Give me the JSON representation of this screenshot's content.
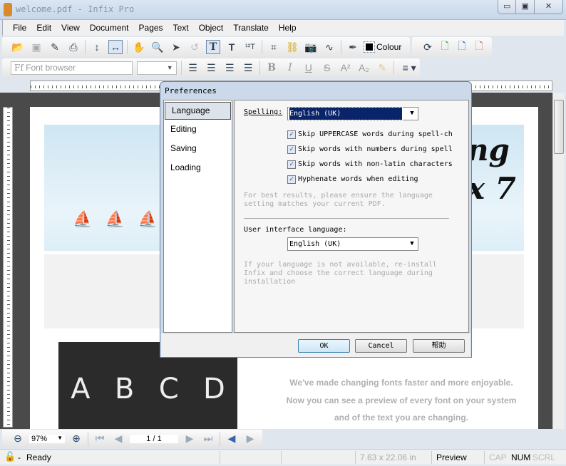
{
  "window": {
    "title": "welcome.pdf - Infix Pro",
    "minimize": "▭",
    "maximize": "▣",
    "close": "✕"
  },
  "menu": [
    "File",
    "Edit",
    "View",
    "Document",
    "Pages",
    "Text",
    "Object",
    "Translate",
    "Help"
  ],
  "toolbar": {
    "colour_label": "Colour",
    "font_browser_placeholder": "Font browser"
  },
  "document": {
    "heading_fragment_1": "ng",
    "heading_fragment_2": "x 7",
    "chalk_letters": [
      "A",
      "B",
      "C",
      "D"
    ],
    "lines": [
      "We've made changing fonts faster and more enjoyable.",
      "Now you can see a preview of every font on your system",
      "and of the text you are changing."
    ]
  },
  "dialog": {
    "title": "Preferences",
    "categories": [
      "Language",
      "Editing",
      "Saving",
      "Loading"
    ],
    "spelling_label": "Spelling:",
    "spelling_value": "English (UK)",
    "checkboxes": [
      "Skip UPPERCASE words during spell-ch",
      "Skip words with numbers during spell",
      "Skip words with non-latin characters",
      "Hyphenate words when editing"
    ],
    "hint1_line1": "For best results, please ensure the language",
    "hint1_line2": "setting matches your current PDF.",
    "ui_lang_label": "User interface language:",
    "ui_lang_value": "English (UK)",
    "hint2_line1": "If your language is not available, re-install",
    "hint2_line2": "Infix and choose the correct language during",
    "hint2_line3": "installation",
    "ok": "OK",
    "cancel": "Cancel",
    "help": "帮助"
  },
  "bottombar": {
    "zoom": "97%",
    "page": "1 / 1"
  },
  "status": {
    "ready": "Ready",
    "dash": "-",
    "size": "7.63 x 22.06 in",
    "mode": "Preview",
    "caps": "CAP",
    "num": "NUM",
    "scrl": "SCRL"
  }
}
